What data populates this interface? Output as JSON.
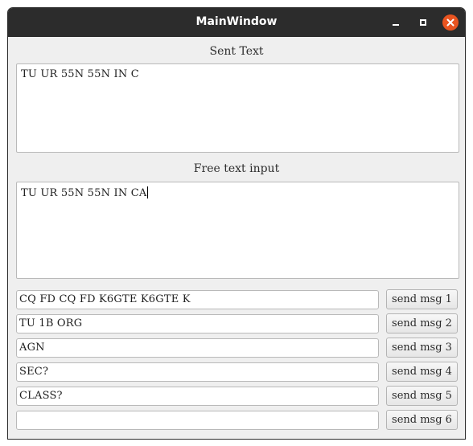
{
  "window": {
    "title": "MainWindow"
  },
  "sent": {
    "label": "Sent Text",
    "text": "TU UR 55N 55N IN C"
  },
  "free": {
    "label": "Free text input",
    "text": "TU UR 55N 55N IN CA"
  },
  "messages": [
    {
      "value": "CQ FD CQ FD K6GTE K6GTE K",
      "button": "send msg 1"
    },
    {
      "value": "TU 1B ORG",
      "button": "send msg 2"
    },
    {
      "value": "AGN",
      "button": "send msg 3"
    },
    {
      "value": "SEC?",
      "button": "send msg 4"
    },
    {
      "value": "CLASS?",
      "button": "send msg 5"
    },
    {
      "value": "",
      "button": "send msg 6"
    }
  ],
  "colors": {
    "titlebar": "#2c2c2c",
    "close_button": "#e95420",
    "window_bg": "#efefef"
  }
}
